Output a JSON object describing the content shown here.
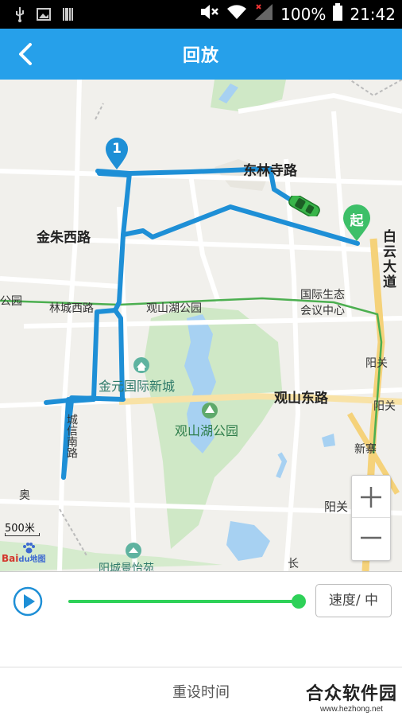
{
  "status_bar": {
    "battery": "100%",
    "time": "21:42"
  },
  "header": {
    "title": "回放"
  },
  "map": {
    "labels": {
      "donglinsi": "东林寺路",
      "jinzhu": "金朱西路",
      "baiyun": "白云大道",
      "gongyuan_left": "公园",
      "lincheng": "林城西路",
      "guanshanhu_park_road": "观山湖公园",
      "guoji": "国际生态",
      "huiyi": "会议中心",
      "yangguan1": "阳关",
      "jinyuan": "金元国际新城",
      "guanshan_east": "观山东路",
      "yangguan2": "阳关",
      "guanshanhu_park": "观山湖公园",
      "xinzhai": "新寨",
      "yangguan3": "阳关",
      "chengxin": "城信南路",
      "chang": "长",
      "bottom_partial": "阳城景怡苑",
      "ao": "奥"
    },
    "marker_number": "1",
    "marker_start": "起",
    "scale": "500米",
    "logo": "Baidu地图",
    "zoom_in": "+",
    "zoom_out": "−"
  },
  "controls": {
    "play_icon": "play-icon",
    "progress": 1.0,
    "speed_label": "速度/ 中",
    "reset_label": "重设时间"
  },
  "watermark": {
    "main": "合众软件园",
    "sub": "www.hezhong.net"
  },
  "colors": {
    "accent": "#26a0ea",
    "track": "#1e8fd6",
    "progress": "#2ed158"
  }
}
